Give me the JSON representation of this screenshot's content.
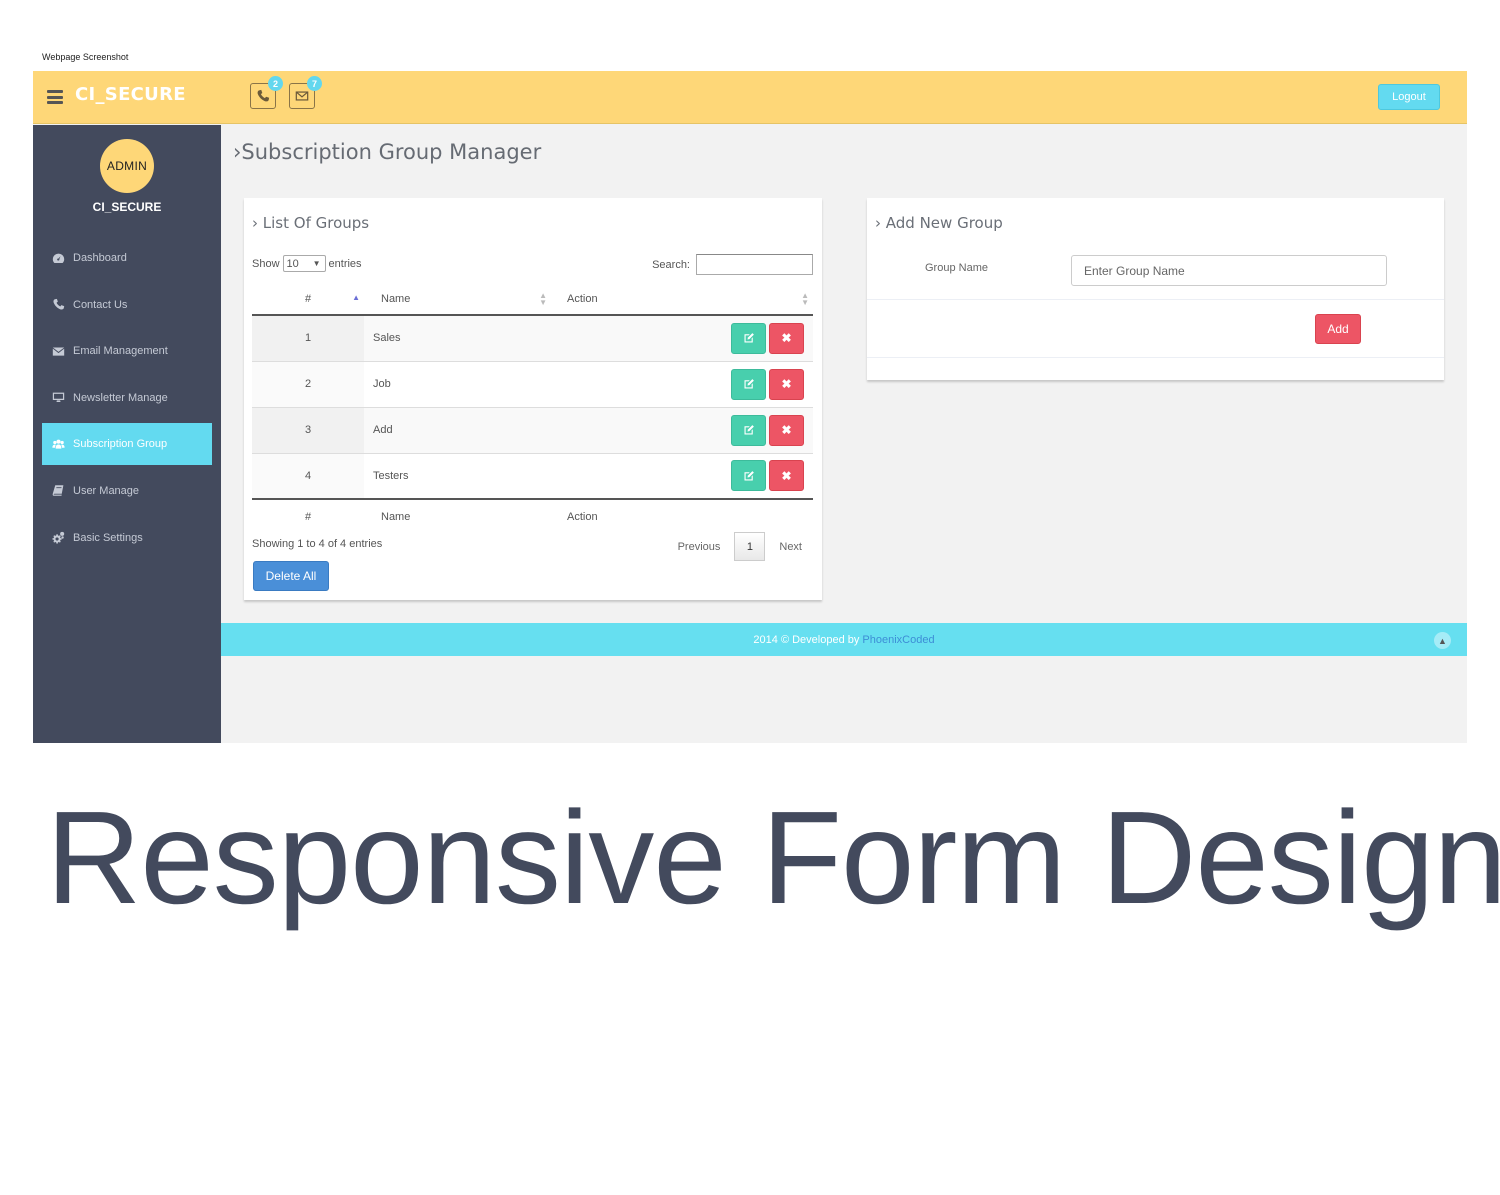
{
  "caption_top": "Webpage Screenshot",
  "header": {
    "brand": "CI_SECURE",
    "phone_badge": "2",
    "mail_badge": "7",
    "logout_label": "Logout"
  },
  "sidebar": {
    "avatar_label": "ADMIN",
    "title": "CI_SECURE",
    "items": [
      {
        "label": "Dashboard",
        "icon": "dashboard-icon"
      },
      {
        "label": "Contact Us",
        "icon": "phone-icon"
      },
      {
        "label": "Email Management",
        "icon": "envelope-icon"
      },
      {
        "label": "Newsletter Manage",
        "icon": "desktop-icon"
      },
      {
        "label": "Subscription Group",
        "icon": "users-icon",
        "active": true
      },
      {
        "label": "User Manage",
        "icon": "book-icon"
      },
      {
        "label": "Basic Settings",
        "icon": "gears-icon"
      }
    ]
  },
  "main": {
    "page_title": "Subscription Group Manager",
    "list_panel": {
      "title": "List Of Groups",
      "show_label": "Show",
      "entries_label": "entries",
      "page_length": "10",
      "search_label": "Search:",
      "search_value": "",
      "columns": [
        "#",
        "Name",
        "Action"
      ],
      "rows": [
        {
          "num": "1",
          "name": "Sales"
        },
        {
          "num": "2",
          "name": "Job"
        },
        {
          "num": "3",
          "name": "Add"
        },
        {
          "num": "4",
          "name": "Testers"
        }
      ],
      "info": "Showing 1 to 4 of 4 entries",
      "pager": {
        "previous": "Previous",
        "current_page": "1",
        "next": "Next"
      },
      "delete_all_label": "Delete All"
    },
    "add_panel": {
      "title": "Add New Group",
      "group_name_label": "Group Name",
      "group_name_placeholder": "Enter Group Name",
      "group_name_value": "",
      "add_label": "Add"
    }
  },
  "footer": {
    "text": "2014 © Developed by",
    "link": "PhoenixCoded"
  },
  "big_caption": "Responsive Form Design",
  "colors": {
    "topbar": "#fed778",
    "sidebar": "#434a5d",
    "accent_cyan": "#63daf0",
    "edit_green": "#48cfad",
    "delete_red": "#ed5565",
    "primary_blue": "#4a8fd8"
  }
}
